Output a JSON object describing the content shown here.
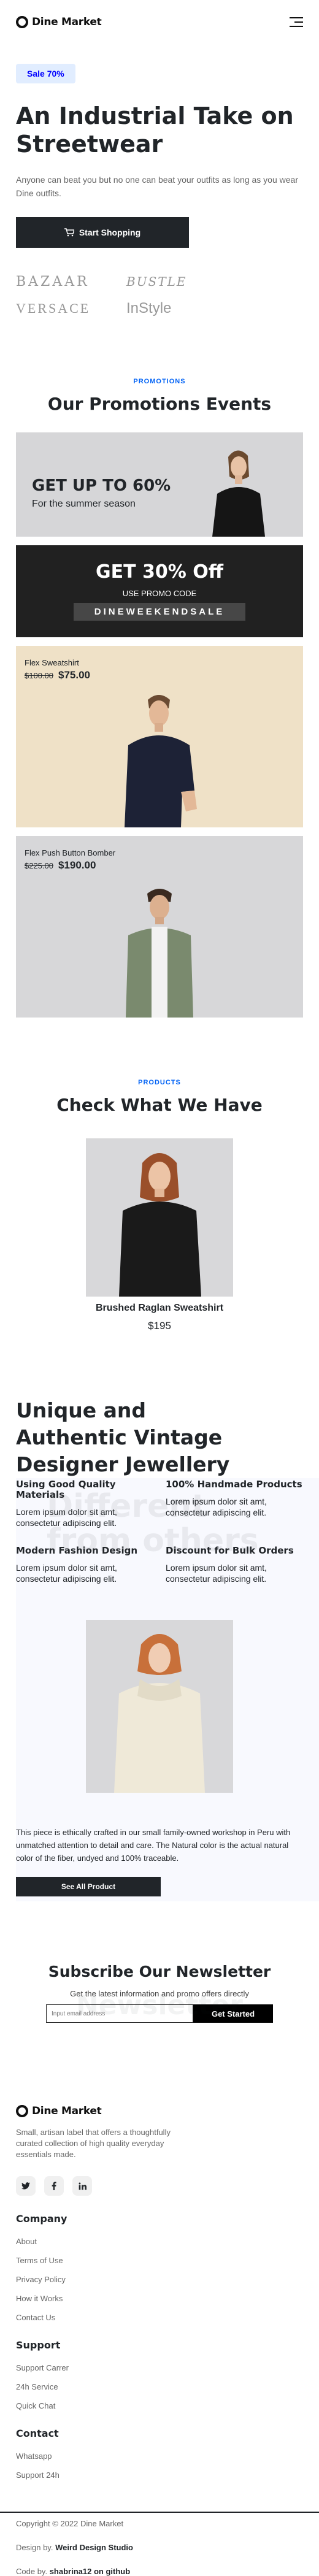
{
  "header": {
    "logo_text": "Dine Market"
  },
  "hero": {
    "badge": "Sale 70%",
    "title": "An Industrial Take on Streetwear",
    "description": "Anyone can beat you but no one can beat your outfits as long as you wear Dine outfits.",
    "cta_label": "Start Shopping",
    "brands": [
      "BAZAAR",
      "BUSTLE",
      "VERSACE",
      "InStyle"
    ]
  },
  "promotions": {
    "kicker": "PROMOTIONS",
    "title": "Our Promotions Events",
    "sale_big": "GET UP TO 60%",
    "sale_small": "For the summer season",
    "code_big": "GET 30% Off",
    "code_label": "USE PROMO CODE",
    "code_value": "DINEWEEKENDSALE",
    "products": [
      {
        "name": "Flex Sweatshirt",
        "old_price": "$100.00",
        "new_price": "$75.00"
      },
      {
        "name": "Flex Push Button Bomber",
        "old_price": "$225.00",
        "new_price": "$190.00"
      }
    ]
  },
  "products": {
    "kicker": "PRODUCTS",
    "title": "Check What We Have",
    "item_name": "Brushed Raglan Sweatshirt",
    "item_price": "$195"
  },
  "unique": {
    "title": "Unique and Authentic Vintage Designer Jewellery",
    "watermark": "Different from others",
    "features": [
      {
        "title": "Using Good Quality Materials",
        "text": "Lorem ipsum dolor sit amt, consectetur adipiscing elit."
      },
      {
        "title": "100% Handmade Products",
        "text": "Lorem ipsum dolor sit amt, consectetur adipiscing elit."
      },
      {
        "title": "Modern Fashion Design",
        "text": "Lorem ipsum dolor sit amt, consectetur adipiscing elit."
      },
      {
        "title": "Discount for Bulk Orders",
        "text": "Lorem ipsum dolor sit amt, consectetur adipiscing elit."
      }
    ],
    "description": "This piece is ethically crafted in our small family-owned workshop in Peru with unmatched attention to detail and care. The Natural color is the actual natural color of the fiber, undyed and 100% traceable.",
    "cta_label": "See All Product"
  },
  "newsletter": {
    "title": "Subscribe Our Newsletter",
    "watermark": "Newsletter",
    "subtitle": "Get the latest information and promo offers directly",
    "input_placeholder": "Input email address",
    "button_label": "Get Started"
  },
  "footer": {
    "logo_text": "Dine Market",
    "about": "Small, artisan label that offers a thoughtfully curated collection of high quality everyday essentials made.",
    "socials": [
      "twitter-icon",
      "facebook-icon",
      "linkedin-icon"
    ],
    "columns": [
      {
        "title": "Company",
        "links": [
          "About",
          "Terms of Use",
          "Privacy Policy",
          "How it Works",
          "Contact Us"
        ]
      },
      {
        "title": "Support",
        "links": [
          "Support Carrer",
          "24h Service",
          "Quick Chat"
        ]
      },
      {
        "title": "Contact",
        "links": [
          "Whatsapp",
          "Support 24h"
        ]
      }
    ],
    "copyright": "Copyright © 2022 Dine Market",
    "design_prefix": "Design by.",
    "design_by": "Weird Design Studio",
    "code_prefix": "Code by.",
    "code_by": "shabrina12 on github"
  }
}
